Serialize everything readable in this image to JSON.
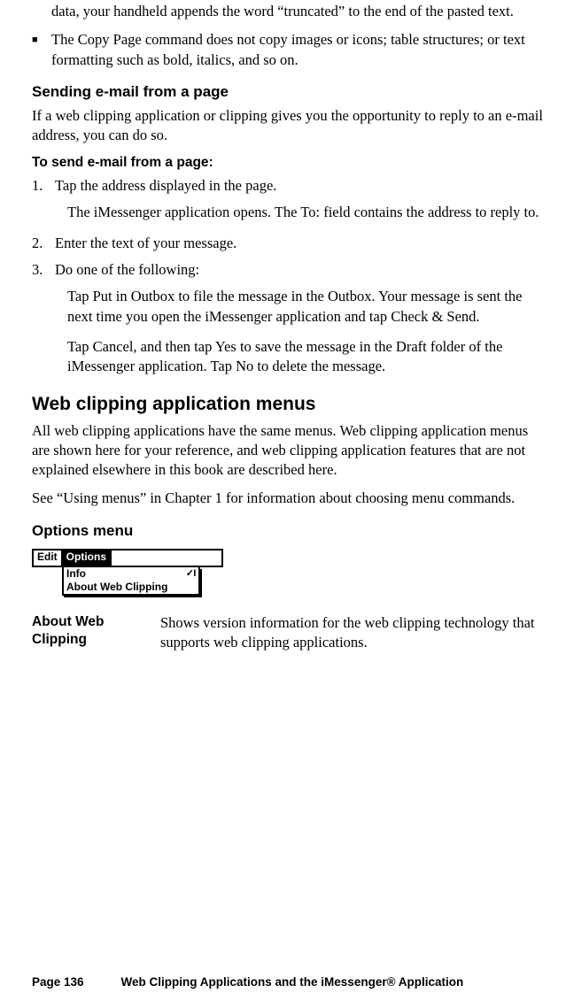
{
  "intro_cont": "data, your handheld appends the word “truncated” to the end of the pasted text.",
  "bullet2": "The Copy Page command does not copy images or icons; table structures; or text formatting such as bold, italics, and so on.",
  "sec_send_email": "Sending e-mail from a page",
  "send_intro": "If a web clipping application or clipping gives you the opportunity to reply to an e-mail address, you can do so.",
  "send_steps_heading": "To send e-mail from a page:",
  "steps": {
    "n1": "1.",
    "t1": "Tap the address displayed in the page.",
    "s1a": "The iMessenger application opens. The To: field contains the address to reply to.",
    "n2": "2.",
    "t2": "Enter the text of your message.",
    "n3": "3.",
    "t3": "Do one of the following:",
    "s3a": "Tap Put in Outbox to file the message in the Outbox. Your mes­sage is sent the next time you open the iMessenger application and tap Check & Send.",
    "s3b": "Tap Cancel, and then tap Yes to save the message in the Draft folder of the iMessenger application. Tap No to delete the message."
  },
  "sec_menus": "Web clipping application menus",
  "menus_p1": "All web clipping applications have the same menus. Web clipping application menus are shown here for your reference, and web clipping application features that are not explained elsewhere in this book are described here.",
  "menus_p2": "See “Using menus” in Chapter 1 for information about choosing menu commands.",
  "sec_options": "Options menu",
  "menu": {
    "tab_edit": "Edit",
    "tab_options": "Options",
    "item_info": "Info",
    "shortcut_info": "✓I",
    "item_about": "About Web Clipping"
  },
  "def_term": "About Web Clipping",
  "def_desc": "Shows version information for the web clipping technology that supports web clipping applications.",
  "footer_page": "Page 136",
  "footer_chapter": "Web Clipping Applications and the iMessenger® Application"
}
